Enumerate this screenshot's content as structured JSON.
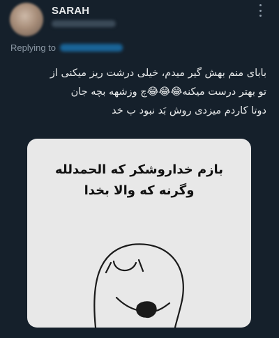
{
  "author": {
    "name": "SARAH"
  },
  "reply": {
    "label": "Replying to"
  },
  "tweet": {
    "lines": [
      "بابای منم بهش گیر میدم، خیلی درشت ریز میکنی از",
      "تو بهتر درست میکنه😂😂😂چ وزشهه بچه جان",
      "دوتا کاردم میزدی روش بَد نبود ب خد"
    ]
  },
  "media": {
    "caption_lines": [
      "بازم خداروشکر که الحمدلله",
      "وگرنه که والا بخدا"
    ]
  },
  "icons": {
    "more": "more-options-icon"
  },
  "colors": {
    "background": "#15202b",
    "text": "#e7e9ea",
    "muted": "#8b98a5",
    "accent": "#1d9bf0",
    "media_bg": "#e8e8e8"
  }
}
